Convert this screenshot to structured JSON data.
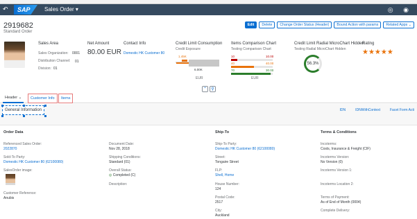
{
  "shell": {
    "back": "↶",
    "logo": "SAP",
    "title": "Sales Order ▾",
    "right_icons": "◎ ◉"
  },
  "header": {
    "title": "2919682",
    "subtitle": "Standard Order",
    "actions": [
      "Edit",
      "Delete",
      "Change Order Status (Header)",
      "Bound Action with params",
      "Related Apps ⌄"
    ]
  },
  "kpis": {
    "sales_area": {
      "title": "Sales Area",
      "org_label": "Sales Organization:",
      "org": "0001",
      "dist_label": "Distribution Channel:",
      "dist": "01",
      "div_label": "Division:",
      "div": "01"
    },
    "net_amount": {
      "title": "Net Amount",
      "value": "80.00 EUR"
    },
    "contact": {
      "title": "Contact Info",
      "value": "Domestic HK Customer 80"
    },
    "credit": {
      "title": "Credit Limit Consumption",
      "sub": "Credit Exposure",
      "top": "1.45K",
      "axis": "6.00K",
      "unit": "EUR"
    },
    "items_chart": {
      "title": "Items Comparison Chart",
      "sub": "Testing Comparison Chart",
      "rows": [
        {
          "label": "10",
          "value": "10.00",
          "fraction": 0.15,
          "color": "#bb0000"
        },
        {
          "label": "40",
          "value": "40.00",
          "fraction": 0.55,
          "color": "#e9730c"
        },
        {
          "label": "70",
          "value": "30.00",
          "fraction": 0.95,
          "color": "#2b7d2b"
        }
      ],
      "unit": "EUR"
    },
    "radial": {
      "title": "Credit Limit Radial MicroChart Hidden",
      "sub": "Testing Radial MicroChart Hidden",
      "value": "56.3%"
    },
    "rating": {
      "title": "Rating",
      "stars": "★★★★★"
    }
  },
  "collapse": {
    "up": "⌃",
    "pin": "⚲"
  },
  "tabs": [
    "Header ⌄",
    "Customer Info",
    "Items"
  ],
  "section": {
    "title": "General Information",
    "links": [
      "IDN",
      "IDNWithContext",
      "Facet Form Acti"
    ]
  },
  "cols": {
    "order": {
      "head": "Order Data",
      "f1_l": "Referenced Sales Order:",
      "f1_v": "2022870",
      "f2_l": "Sold-To Party:",
      "f2_v": "Domestic HK Customer 80 (62100080)",
      "f3_l": "SalesOrder image:",
      "f4_l": "Customer Reference:",
      "f4_v": "Anubis"
    },
    "order2": {
      "f1_l": "Document Date:",
      "f1_v": "Nov 28, 2018",
      "f2_l": "Shipping Conditions:",
      "f2_v": "Standard (01)",
      "f3_l": "Overall Status:",
      "f3_v": "Completed (C)",
      "f4_l": "Description:"
    },
    "ship": {
      "head": "Ship-To",
      "f1_l": "Ship-To Party:",
      "f1_v": "Domestic HK Customer 80 (62100080)",
      "f2_l": "Street:",
      "f2_v": "Tongaire Street",
      "f3_l": "FLP:",
      "f3_v": "Shell, Home",
      "f4_l": "House Number:",
      "f4_v": "124",
      "f5_l": "Postal Code:",
      "f5_v": "2517",
      "f6_l": "City:",
      "f6_v": "Auckland"
    },
    "terms": {
      "head": "Terms & Conditions",
      "f1_l": "Incoterms:",
      "f1_v": "Costs, Insurance & Freight (CIF)",
      "f2_l": "Incoterms Version:",
      "f2_v": "No Version (0)",
      "f3_l": "Incoterms Version 1:",
      "f4_l": "Incoterms Location 2:",
      "f5_l": "Terms of Payment:",
      "f5_v": "As of End of Month (0004)",
      "f6_l": "Complete Delivery:"
    }
  }
}
